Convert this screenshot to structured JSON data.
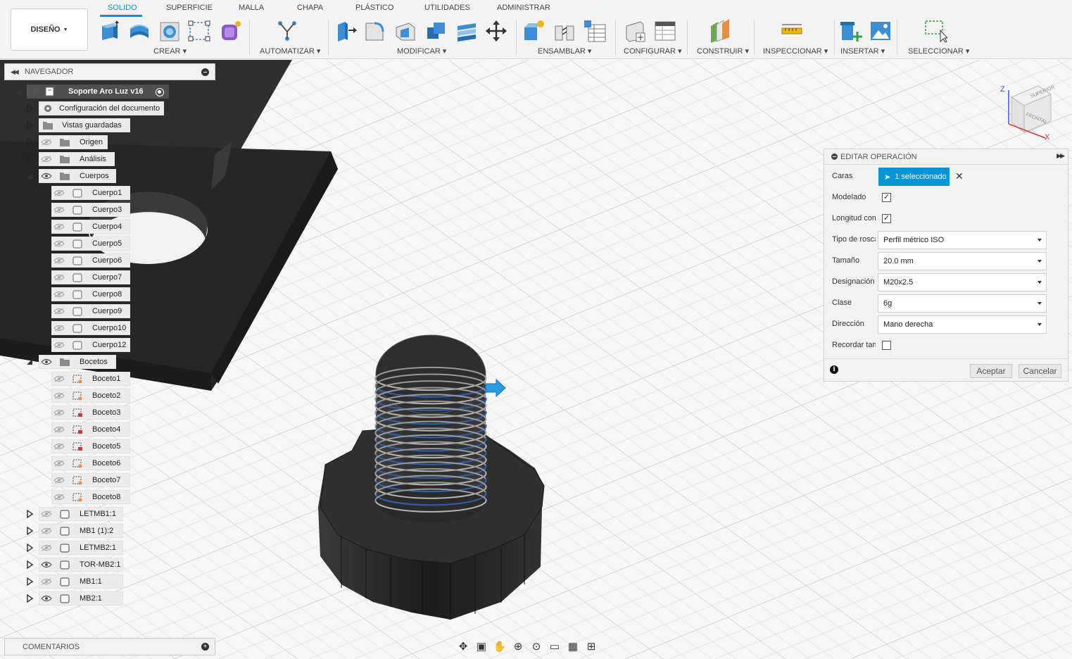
{
  "workspace": {
    "label": "DISEÑO"
  },
  "tabs": [
    "SOLIDO",
    "SUPERFICIE",
    "MALLA",
    "CHAPA",
    "PLÁSTICO",
    "UTILIDADES",
    "ADMINISTRAR"
  ],
  "active_tab": "SOLIDO",
  "groups": {
    "crear": "CREAR",
    "automatizar": "AUTOMATIZAR",
    "modificar": "MODIFICAR",
    "ensamblar": "ENSAMBLAR",
    "configurar": "CONFIGURAR",
    "construir": "CONSTRUIR",
    "inspeccionar": "INSPECCIONAR",
    "insertar": "INSERTAR",
    "seleccionar": "SELECCIONAR"
  },
  "navigator": {
    "title": "NAVEGADOR",
    "root": "Soporte Aro Luz v16",
    "items": {
      "config": "Configuración del documento",
      "vistas": "Vistas guardadas",
      "origen": "Origen",
      "analisis": "Análisis",
      "cuerpos": "Cuerpos",
      "bocetos": "Bocetos"
    },
    "bodies": [
      "Cuerpo1",
      "Cuerpo3",
      "Cuerpo4",
      "Cuerpo5",
      "Cuerpo6",
      "Cuerpo7",
      "Cuerpo8",
      "Cuerpo9",
      "Cuerpo10",
      "Cuerpo12"
    ],
    "sketches": [
      "Boceto1",
      "Boceto2",
      "Boceto3",
      "Boceto4",
      "Boceto5",
      "Boceto6",
      "Boceto7",
      "Boceto8"
    ],
    "components": [
      "LETMB1:1",
      "MB1 (1):2",
      "LETMB2:1",
      "TOR-MB2:1",
      "MB1:1",
      "MB2:1"
    ]
  },
  "comments": {
    "title": "COMENTARIOS"
  },
  "viewcube": {
    "top": "SUPERIOR",
    "front": "FRONTAL",
    "axis_z": "Z",
    "axis_x": "X"
  },
  "edit_panel": {
    "title": "EDITAR OPERACIÓN",
    "rows": {
      "caras": {
        "label": "Caras",
        "value": "1 seleccionado"
      },
      "modelado": {
        "label": "Modelado",
        "checked": true
      },
      "longitud": {
        "label": "Longitud completa",
        "checked": true
      },
      "tipo": {
        "label": "Tipo de rosca",
        "value": "Perfil métrico ISO"
      },
      "tamano": {
        "label": "Tamaño",
        "value": "20.0 mm"
      },
      "designacion": {
        "label": "Designación",
        "value": "M20x2.5"
      },
      "clase": {
        "label": "Clase",
        "value": "6g"
      },
      "direccion": {
        "label": "Dirección",
        "value": "Mano derecha"
      },
      "recordar": {
        "label": "Recordar tamaño",
        "checked": false
      }
    },
    "ok": "Aceptar",
    "cancel": "Cancelar"
  },
  "colors": {
    "accent": "#0696d7",
    "body": "#2b2b2b",
    "grid": "#dadada"
  }
}
